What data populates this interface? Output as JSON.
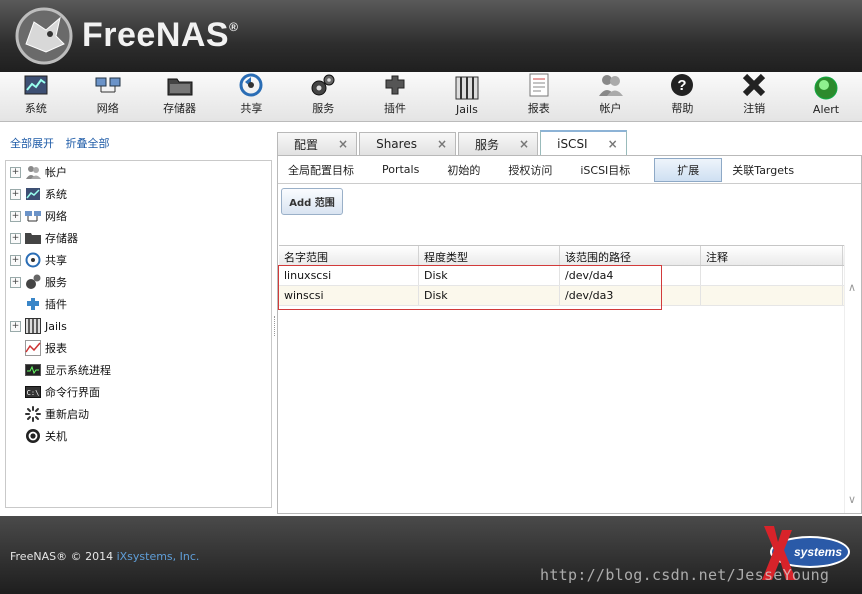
{
  "header": {
    "brand": "FreeNAS",
    "reg": "®"
  },
  "toolbar": [
    {
      "label": "系统",
      "icon": "system-icon"
    },
    {
      "label": "网络",
      "icon": "network-icon"
    },
    {
      "label": "存储器",
      "icon": "storage-icon"
    },
    {
      "label": "共享",
      "icon": "sharing-icon"
    },
    {
      "label": "服务",
      "icon": "services-icon"
    },
    {
      "label": "插件",
      "icon": "plugins-icon"
    },
    {
      "label": "Jails",
      "icon": "jails-icon"
    },
    {
      "label": "报表",
      "icon": "reports-icon"
    },
    {
      "label": "帐户",
      "icon": "account-icon"
    },
    {
      "label": "帮助",
      "icon": "help-icon"
    },
    {
      "label": "注销",
      "icon": "logout-icon"
    },
    {
      "label": "Alert",
      "icon": "alert-icon"
    }
  ],
  "left": {
    "expand_all": "全部展开",
    "collapse_all": "折叠全部",
    "tree": [
      {
        "label": "帐户",
        "expandable": true
      },
      {
        "label": "系统",
        "expandable": true
      },
      {
        "label": "网络",
        "expandable": true
      },
      {
        "label": "存储器",
        "expandable": true
      },
      {
        "label": "共享",
        "expandable": true
      },
      {
        "label": "服务",
        "expandable": true
      },
      {
        "label": "插件",
        "expandable": false
      },
      {
        "label": "Jails",
        "expandable": true
      },
      {
        "label": "报表",
        "expandable": false
      },
      {
        "label": "显示系统进程",
        "expandable": false
      },
      {
        "label": "命令行界面",
        "expandable": false
      },
      {
        "label": "重新启动",
        "expandable": false
      },
      {
        "label": "关机",
        "expandable": false
      }
    ]
  },
  "tabs": [
    {
      "label": "配置",
      "close": "×"
    },
    {
      "label": "Shares",
      "close": "×"
    },
    {
      "label": "服务",
      "close": "×"
    },
    {
      "label": "iSCSI",
      "close": "×"
    }
  ],
  "subtabs": [
    "全局配置目标",
    "Portals",
    "初始的",
    "授权访问",
    "iSCSI目标",
    "扩展",
    "关联Targets"
  ],
  "add_button": "Add 范围",
  "grid": {
    "headers": [
      "名字范围",
      "程度类型",
      "该范围的路径",
      "注释"
    ],
    "rows": [
      [
        "linuxscsi",
        "Disk",
        "/dev/da4",
        ""
      ],
      [
        "winscsi",
        "Disk",
        "/dev/da3",
        ""
      ]
    ]
  },
  "footer": {
    "copyright": "FreeNAS® © 2014 ",
    "company": "iXsystems, Inc.",
    "watermark": "http://blog.csdn.net/JesseYoung",
    "logo_text": "systems"
  },
  "colors": {
    "accent": "#8db3d6",
    "highlight": "#d23a3a",
    "link": "#1f5ca8"
  }
}
